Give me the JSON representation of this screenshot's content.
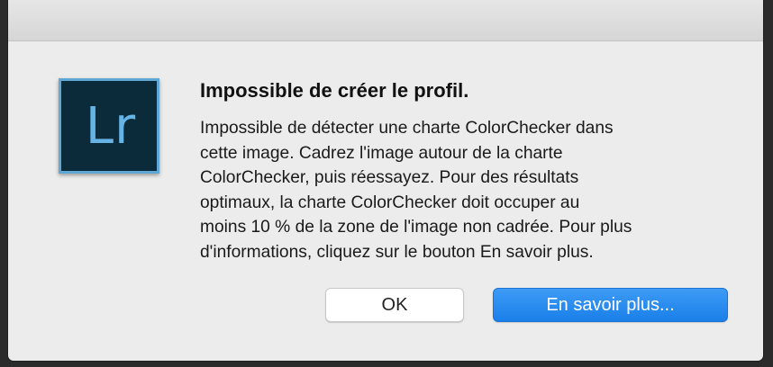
{
  "app_icon": {
    "name": "lightroom-icon",
    "label": "Lr",
    "bg_color": "#0c2b3a",
    "accent_color": "#66b4e6"
  },
  "dialog": {
    "title": "Impossible de créer le profil.",
    "message_lines": [
      "Impossible de détecter une charte ColorChecker dans",
      "cette image. Cadrez l'image autour de la charte",
      "ColorChecker, puis réessayez. Pour des résultats",
      "optimaux, la charte ColorChecker doit occuper au",
      "moins 10 % de la zone de l'image non cadrée. Pour plus",
      "d'informations, cliquez sur le bouton En savoir plus."
    ]
  },
  "buttons": {
    "ok_label": "OK",
    "learn_more_label": "En savoir plus...",
    "primary_color": "#1a7fe9"
  }
}
